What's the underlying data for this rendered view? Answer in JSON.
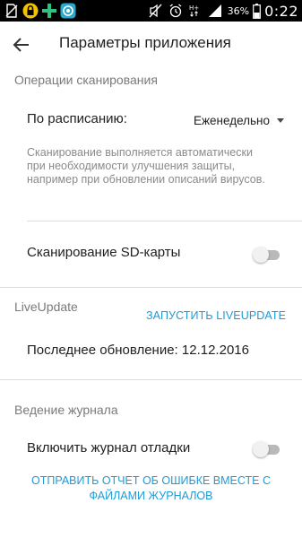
{
  "status_bar": {
    "icons_left": [
      "no-sim-icon",
      "lock-icon",
      "green-cross-icon",
      "swirl-app-icon"
    ],
    "icons_right": [
      "mute-icon",
      "alarm-icon",
      "signal-hplus-icon",
      "signal-bars-icon"
    ],
    "battery_percent": "36%",
    "time": "0:22"
  },
  "app_bar": {
    "title": "Параметры приложения"
  },
  "scan_section": {
    "header": "Операции сканирования",
    "schedule_label": "По расписанию:",
    "schedule_value": "Еженедельно",
    "description": "Сканирование выполняется автоматически при необходимости улучшения защиты, например при обновлении описаний вирусов.",
    "sd_scan_label": "Сканирование SD-карты",
    "sd_scan_enabled": false
  },
  "liveupdate_section": {
    "header": "LiveUpdate",
    "run_button": "ЗАПУСТИТЬ LIVEUPDATE",
    "last_update_label": "Последнее обновление: 12.12.2016"
  },
  "logging_section": {
    "header": "Ведение журнала",
    "debug_log_label": "Включить журнал отладки",
    "debug_log_enabled": false,
    "report_button": "ОТПРАВИТЬ ОТЧЕТ ОБ ОШИБКЕ ВМЕСТЕ С ФАЙЛАМИ ЖУРНАЛОВ"
  },
  "colors": {
    "accent": "#1f9ad6",
    "section_header": "#7a7a7a",
    "description": "#8a8a8a",
    "status_bar": "#000000"
  }
}
